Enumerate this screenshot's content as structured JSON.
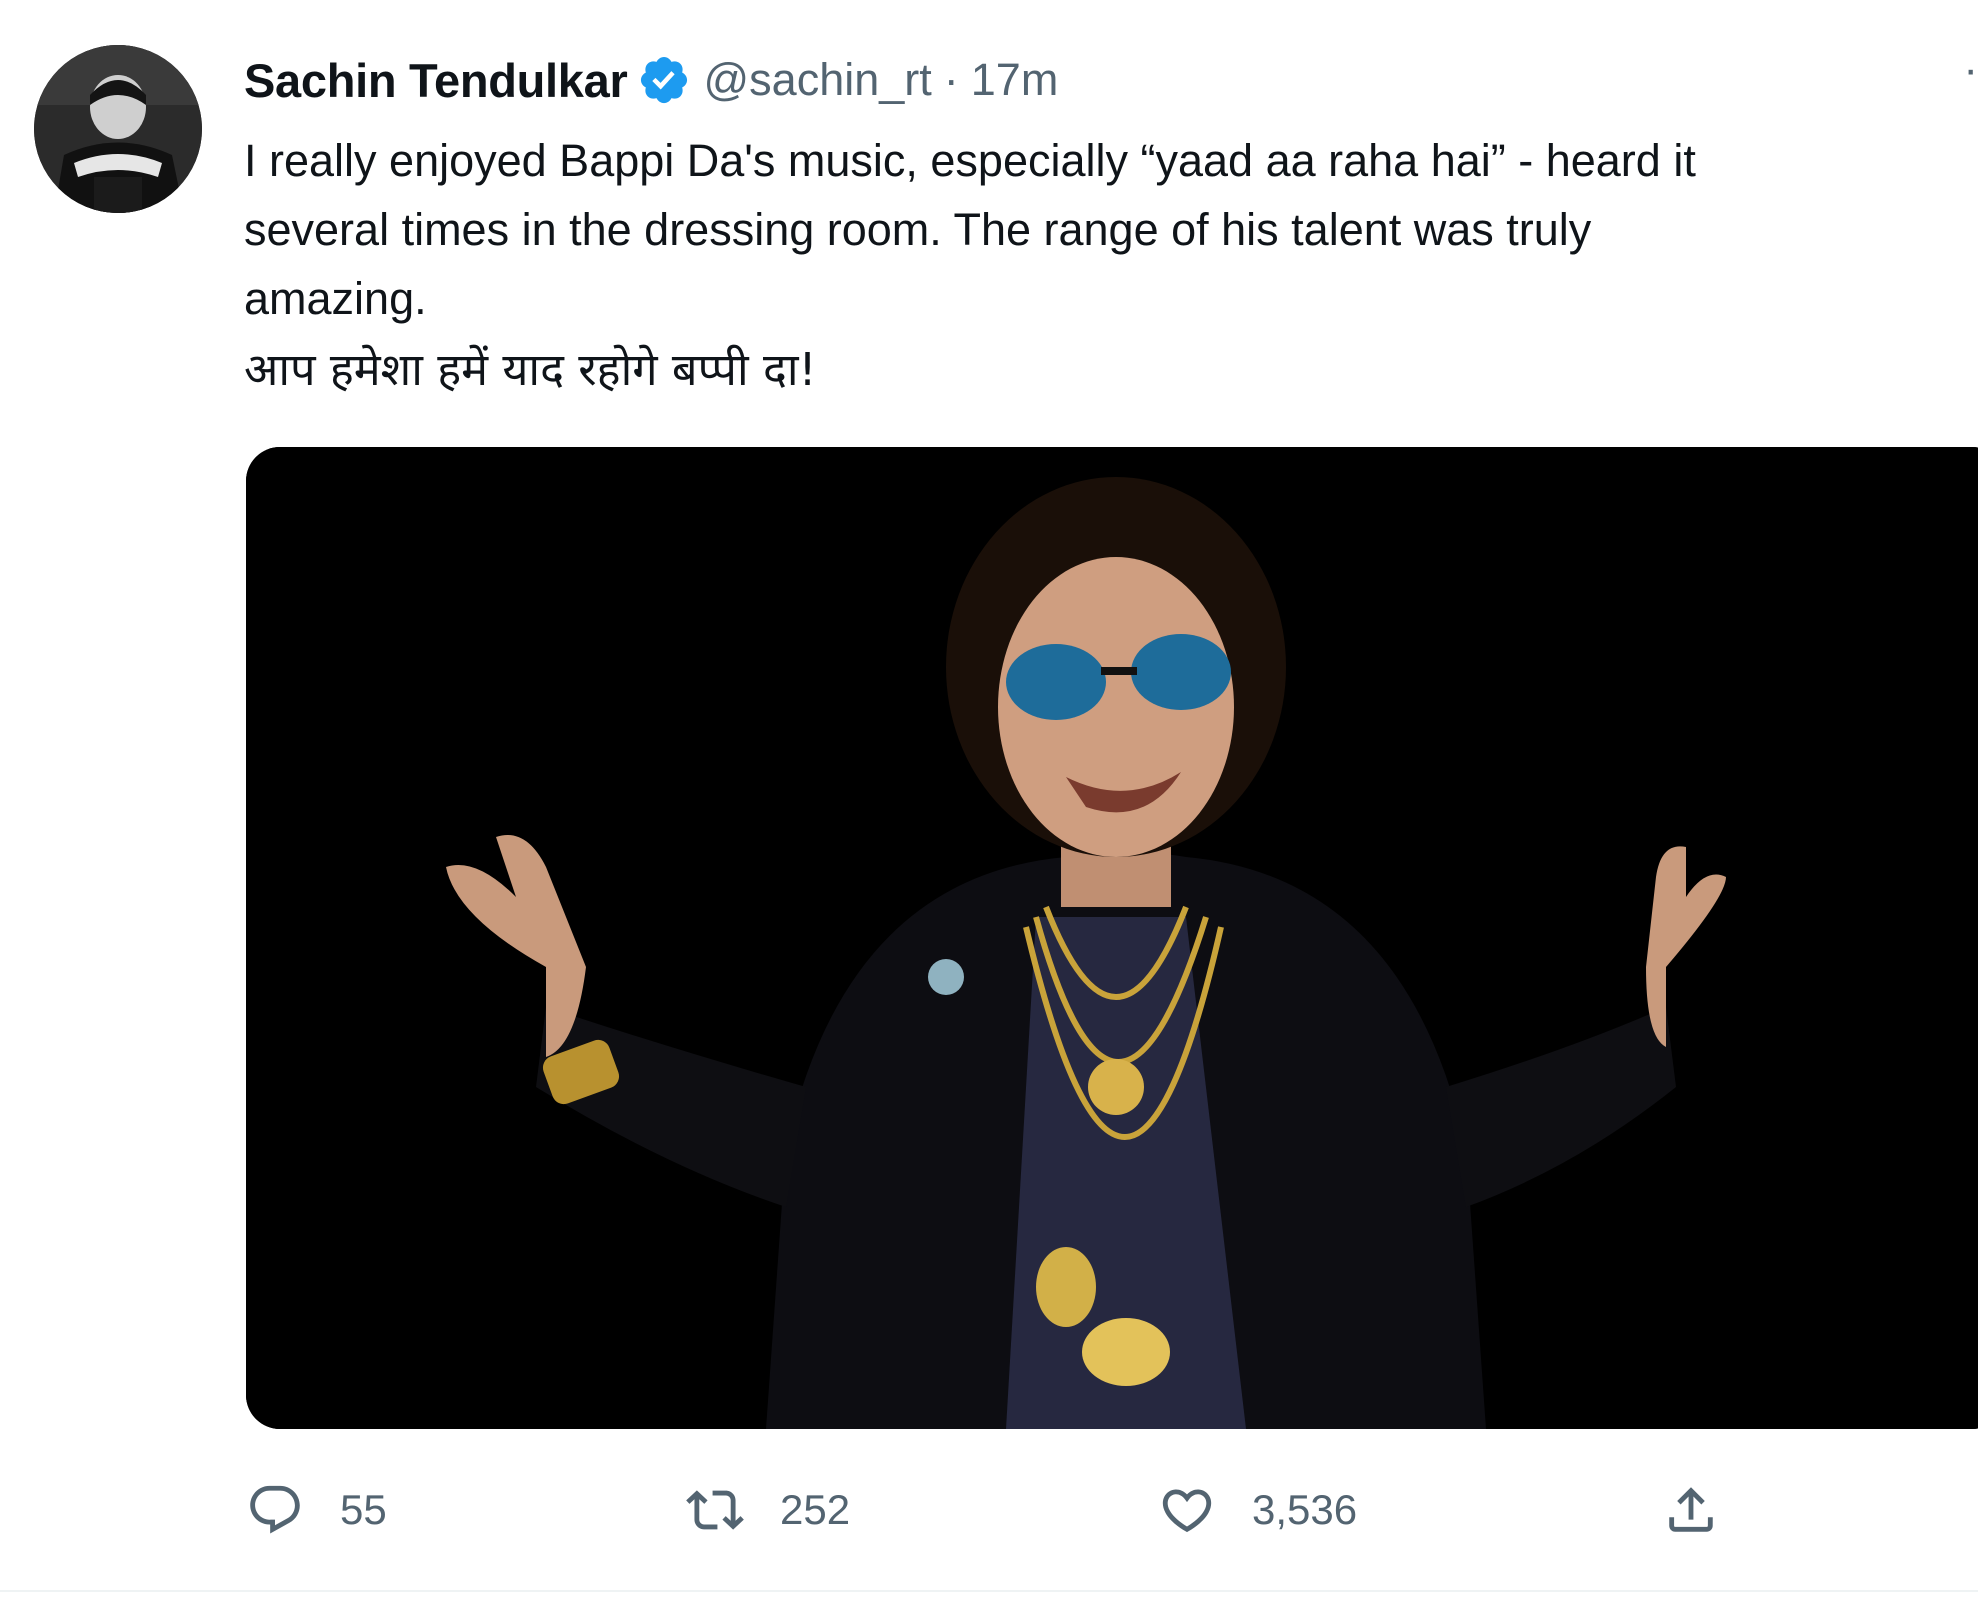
{
  "tweet": {
    "author": {
      "display_name": "Sachin Tendulkar",
      "handle": "@sachin_rt",
      "verified": true
    },
    "separator": "·",
    "time": "17m",
    "text_lines": [
      "I really enjoyed Bappi Da's music, especially “yaad aa raha hai” - heard it",
      "several times in the dressing room. The range of his talent was truly",
      "amazing."
    ],
    "hindi_line": "आप हमेशा हमें याद रहोगे बप्पी दा!",
    "more_icon": "more-dots-icon",
    "actions": {
      "reply": {
        "icon": "reply-icon",
        "count": "55"
      },
      "retweet": {
        "icon": "retweet-icon",
        "count": "252"
      },
      "like": {
        "icon": "like-icon",
        "count": "3,536"
      },
      "share": {
        "icon": "share-icon"
      }
    }
  },
  "colors": {
    "text_primary": "#0f1419",
    "text_secondary": "#536471",
    "verified_blue": "#1d9bf0",
    "media_background": "#000000"
  }
}
